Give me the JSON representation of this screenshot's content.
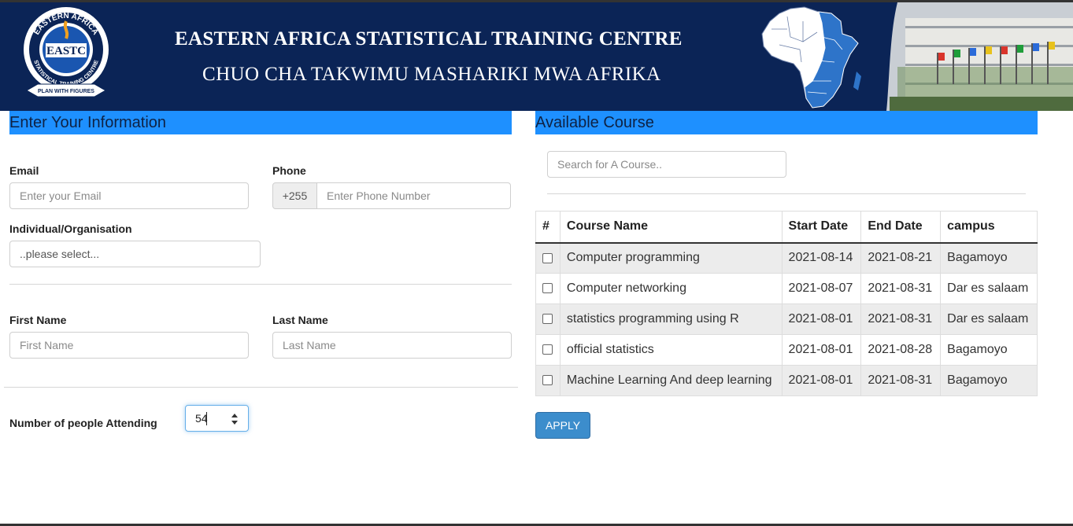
{
  "header": {
    "title": "EASTERN AFRICA STATISTICAL TRAINING CENTRE",
    "subtitle": "CHUO CHA TAKWIMU MASHARIKI MWA AFRIKA",
    "logo": {
      "ring_top": "EASTERN AFRICA",
      "ring_side": "STATISTICAL TRAINING CENTRE",
      "monogram": "EASTC",
      "motto": "PLAN WITH FIGURES"
    }
  },
  "colors": {
    "banner": "#0b2456",
    "section_header": "#1e90ff",
    "apply_button": "#3c8dcc"
  },
  "info_form": {
    "heading": "Enter Your Information",
    "email_label": "Email",
    "email_placeholder": "Enter your Email",
    "phone_label": "Phone",
    "phone_prefix": "+255",
    "phone_placeholder": "Enter Phone Number",
    "type_label": "Individual/Organisation",
    "type_selected": "..please select...",
    "first_name_label": "First Name",
    "first_name_placeholder": "First Name",
    "last_name_label": "Last Name",
    "last_name_placeholder": "Last Name",
    "attendees_label": "Number of people Attending",
    "attendees_value": "54"
  },
  "courses": {
    "heading": "Available Course",
    "search_placeholder": "Search for A Course..",
    "columns": [
      "#",
      "Course Name",
      "Start Date",
      "End Date",
      "campus"
    ],
    "rows": [
      {
        "name": "Computer programming",
        "start": "2021-08-14",
        "end": "2021-08-21",
        "campus": "Bagamoyo"
      },
      {
        "name": "Computer networking",
        "start": "2021-08-07",
        "end": "2021-08-31",
        "campus": "Dar es salaam"
      },
      {
        "name": "statistics programming using R",
        "start": "2021-08-01",
        "end": "2021-08-31",
        "campus": "Dar es salaam"
      },
      {
        "name": "official statistics",
        "start": "2021-08-01",
        "end": "2021-08-28",
        "campus": "Bagamoyo"
      },
      {
        "name": "Machine Learning And deep learning",
        "start": "2021-08-01",
        "end": "2021-08-31",
        "campus": "Bagamoyo"
      }
    ],
    "apply_label": "APPLY"
  }
}
